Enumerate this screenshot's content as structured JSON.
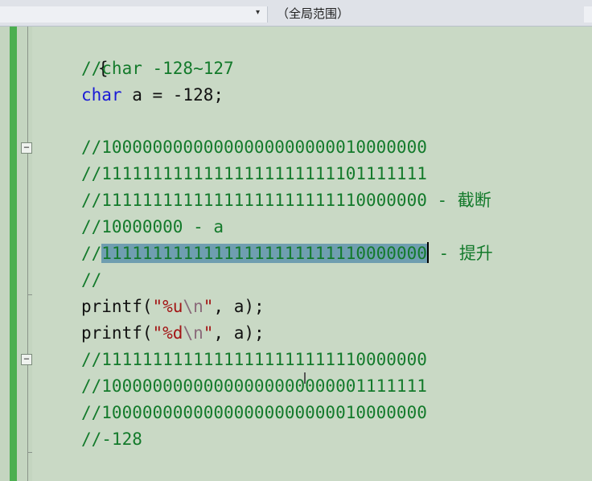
{
  "navbar": {
    "dropdown_arrow": "▾",
    "scope_label": "（全局范围）"
  },
  "editor": {
    "lines": {
      "brace": "{",
      "c1": "//char -128~127",
      "decl_kw": "char",
      "decl_rest": " a = -128;",
      "c2": "//10000000000000000000000010000000",
      "c3": "//11111111111111111111111101111111",
      "c4": "//11111111111111111111111110000000 - ",
      "c4_cn": "截断",
      "c5": "//10000000 - a",
      "c6_prefix": "//",
      "c6_selected": "11111111111111111111111110000000",
      "c6_suffix": " - ",
      "c6_cn": "提升",
      "c7": "//",
      "p1_a": "printf(",
      "p1_str1": "\"%u",
      "p1_esc": "\\n",
      "p1_str2": "\"",
      "p1_b": ", a);",
      "p2_a": "printf(",
      "p2_str1": "\"%d",
      "p2_esc": "\\n",
      "p2_str2": "\"",
      "p2_b": ", a);",
      "c8": "//11111111111111111111111110000000",
      "c9": "//10000000000000000000000001111111",
      "c10": "//10000000000000000000000010000000",
      "c11": "//-128"
    },
    "collapse_symbol": "−"
  }
}
